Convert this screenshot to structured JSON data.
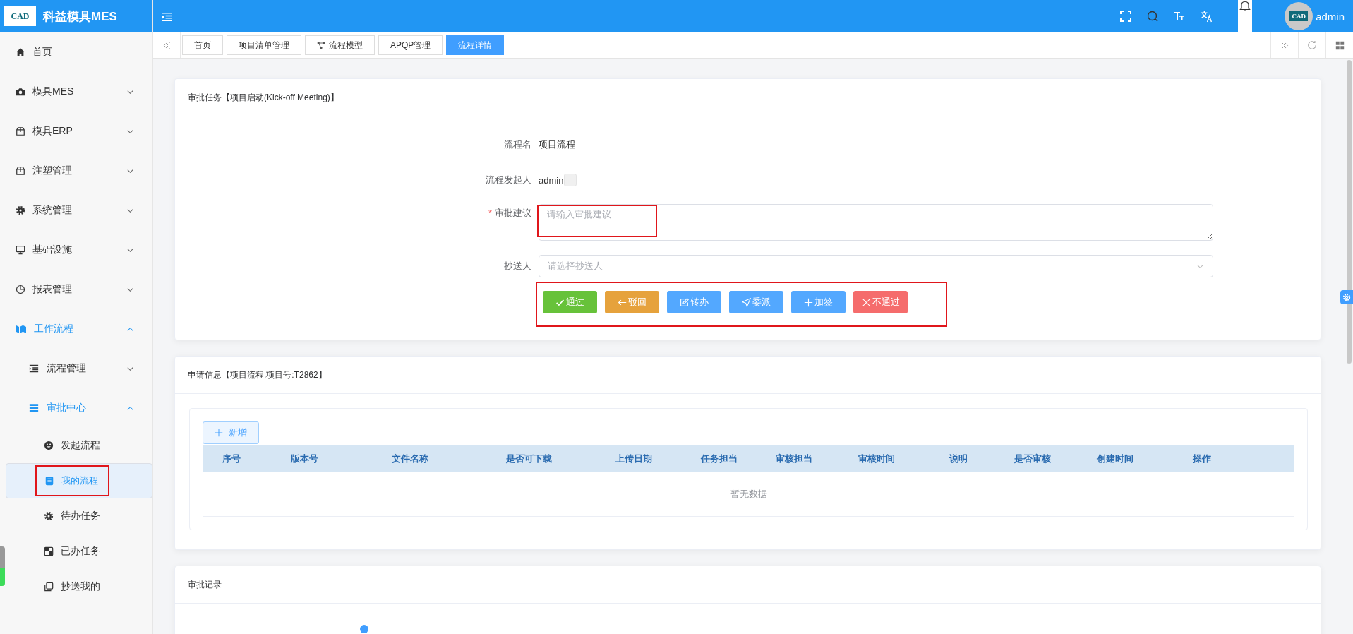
{
  "app": {
    "title": "科益模具MES",
    "logo_text": "CAD"
  },
  "header": {
    "user": "admin",
    "avatar_text": "CAD"
  },
  "sidebar": {
    "items": [
      {
        "label": "首页",
        "kind": "link"
      },
      {
        "label": "模具MES",
        "kind": "group",
        "expanded": false
      },
      {
        "label": "模具ERP",
        "kind": "group",
        "expanded": false
      },
      {
        "label": "注塑管理",
        "kind": "group",
        "expanded": false
      },
      {
        "label": "系统管理",
        "kind": "group",
        "expanded": false
      },
      {
        "label": "基础设施",
        "kind": "group",
        "expanded": false
      },
      {
        "label": "报表管理",
        "kind": "group",
        "expanded": false
      },
      {
        "label": "工作流程",
        "kind": "group",
        "expanded": true,
        "children": [
          {
            "label": "流程管理",
            "kind": "group",
            "expanded": false
          },
          {
            "label": "审批中心",
            "kind": "group",
            "expanded": true,
            "children": [
              {
                "label": "发起流程",
                "kind": "link",
                "selected": false,
                "highlighted": false
              },
              {
                "label": "我的流程",
                "kind": "link",
                "selected": true,
                "highlighted": true
              },
              {
                "label": "待办任务",
                "kind": "link",
                "selected": false,
                "highlighted": false
              },
              {
                "label": "已办任务",
                "kind": "link",
                "selected": false,
                "highlighted": false
              },
              {
                "label": "抄送我的",
                "kind": "link",
                "selected": false,
                "highlighted": false
              }
            ]
          }
        ]
      }
    ]
  },
  "tabs": [
    {
      "label": "首页",
      "selected": false
    },
    {
      "label": "项目清单管理",
      "selected": false
    },
    {
      "label": "流程模型",
      "selected": false
    },
    {
      "label": "APQP管理",
      "selected": false
    },
    {
      "label": "流程详情",
      "selected": true
    }
  ],
  "task_card": {
    "title": "审批任务【项目启动(Kick-off Meeting)】",
    "fields": [
      {
        "kind": "text",
        "label": "流程名",
        "value": "项目流程"
      },
      {
        "kind": "text",
        "label": "流程发起人",
        "value": "admin"
      },
      {
        "kind": "textarea",
        "label": "审批建议",
        "required_mark": "*",
        "placeholder": "请输入审批建议",
        "highlighted": true
      },
      {
        "kind": "select",
        "label": "抄送人",
        "placeholder": "请选择抄送人",
        "highlighted": false
      }
    ],
    "buttons_highlighted": true,
    "buttons": [
      {
        "label": "通过",
        "color": "#67c23a"
      },
      {
        "label": "驳回",
        "color": "#e6a23c"
      },
      {
        "label": "转办",
        "color": "#53a8ff"
      },
      {
        "label": "委派",
        "color": "#53a8ff"
      },
      {
        "label": "加签",
        "color": "#53a8ff"
      },
      {
        "label": "不通过",
        "color": "#f56c6c"
      }
    ]
  },
  "apply_card": {
    "title": "申请信息【项目流程,项目号:T2862】",
    "add_button": "新增",
    "columns": [
      "序号",
      "版本号",
      "文件名称",
      "是否可下载",
      "上传日期",
      "任务担当",
      "审核担当",
      "审核时间",
      "说明",
      "是否审核",
      "创建时间",
      "操作"
    ],
    "empty_text": "暂无数据"
  },
  "record_card": {
    "title": "审批记录"
  }
}
